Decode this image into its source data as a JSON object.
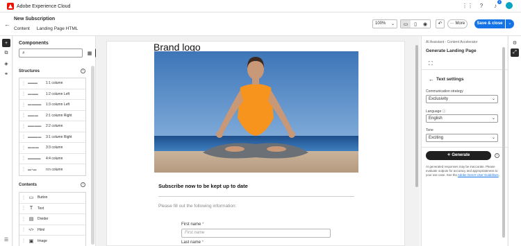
{
  "app": {
    "brand_name": "Adobe Experience Cloud",
    "notification_count": "3"
  },
  "header": {
    "title": "New Subscription",
    "breadcrumb": [
      "Content",
      "Landing Page HTML"
    ],
    "zoom": "100%",
    "more_label": "More",
    "save_label": "Save & close"
  },
  "components": {
    "title": "Components",
    "structures_label": "Structures",
    "structures": [
      {
        "glyph": "▬▬▬",
        "label": "1:1 column"
      },
      {
        "glyph": "▬ ▬▬",
        "label": "1:2 column Left"
      },
      {
        "glyph": "▬ ▬▬▬",
        "label": "1:3 column Left"
      },
      {
        "glyph": "▬▬ ▬",
        "label": "2:1 column Right"
      },
      {
        "glyph": "▬▬ ▬▬",
        "label": "2:2 column"
      },
      {
        "glyph": "▬▬▬ ▬",
        "label": "3:1 column Right"
      },
      {
        "glyph": "▬ ▬ ▬",
        "label": "3:3 column"
      },
      {
        "glyph": "▬▬▬▬",
        "label": "4:4 column"
      },
      {
        "glyph": "▬ ▪ ▬",
        "label": "n:n column"
      }
    ],
    "contents_label": "Contents",
    "contents": [
      {
        "glyph": "▭",
        "label": "Button"
      },
      {
        "glyph": "T",
        "label": "Text"
      },
      {
        "glyph": "▤",
        "label": "Divider"
      },
      {
        "glyph": "</>",
        "label": "Html"
      },
      {
        "glyph": "▣",
        "label": "Image"
      }
    ]
  },
  "canvas": {
    "brand_logo": "Brand logo",
    "subscribe_heading": "Subscribe now to be kept up to date",
    "fill_info": "Please fill out the following information:",
    "first_name_label": "First name",
    "first_name_placeholder": "First name",
    "last_name_label": "Last name",
    "required_mark": "*"
  },
  "assistant": {
    "subtitle": "AI Assistant - Content Accelerator",
    "title": "Generate Landing Page",
    "text_settings_title": "Text settings",
    "strategy_label": "Communication strategy",
    "strategy_value": "Exclusivity",
    "language_label": "Language",
    "language_value": "English",
    "tone_label": "Tone",
    "tone_value": "Exciting",
    "generate_label": "Generate",
    "disclaimer_text": "AI generated responses may be inaccurate. Please evaluate outputs for accuracy and appropriateness to your use case. See the",
    "disclaimer_link": "Adobe GenAI User Guidelines",
    "disclaimer_end": "."
  },
  "colors": {
    "accent": "#1473e6",
    "adobe_red": "#eb1000"
  }
}
